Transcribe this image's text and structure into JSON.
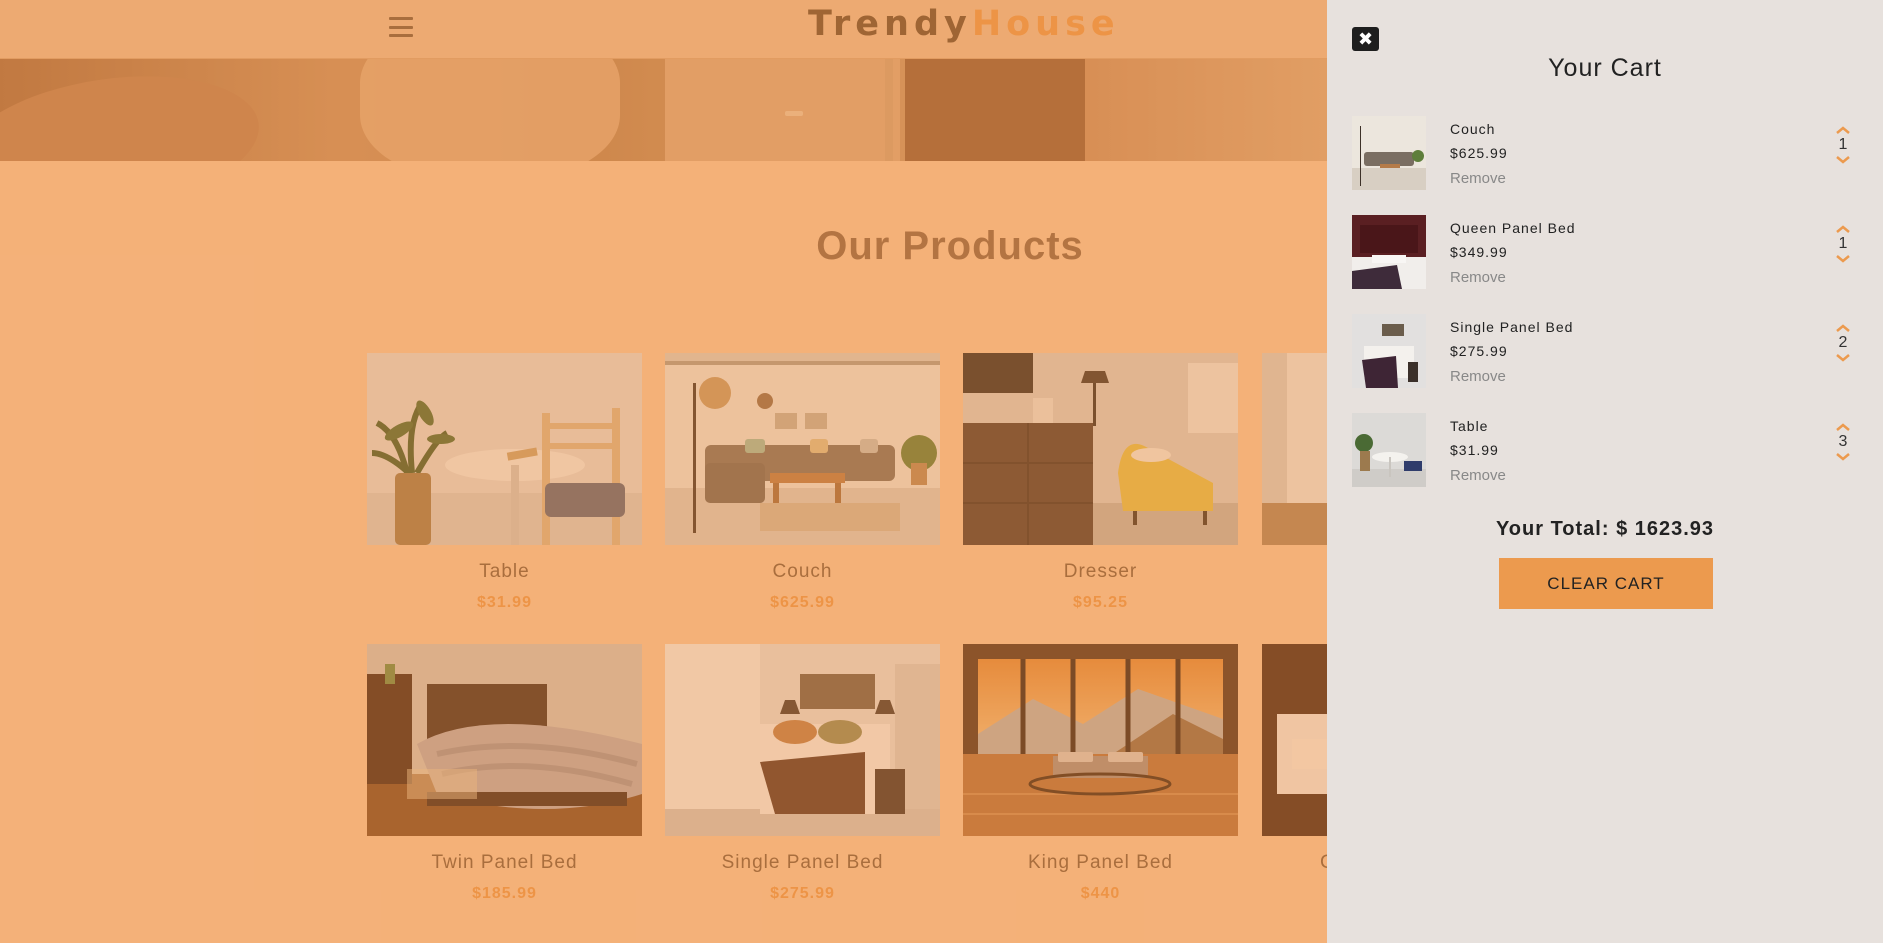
{
  "nav": {
    "menu_icon": "hamburger-icon",
    "logo_part1": "Trendy",
    "logo_part2": "House"
  },
  "products_section": {
    "title": "Our Products",
    "items": [
      {
        "name": "Table",
        "price": "$31.99"
      },
      {
        "name": "Couch",
        "price": "$625.99"
      },
      {
        "name": "Dresser",
        "price": "$95.25"
      },
      {
        "name": "Twin Panel Bed",
        "price": "$185.99"
      },
      {
        "name": "Single Panel Bed",
        "price": "$275.99"
      },
      {
        "name": "King Panel Bed",
        "price": "$440"
      },
      {
        "name": "C",
        "price": ""
      }
    ]
  },
  "cart": {
    "close_icon": "close-icon",
    "title": "Your Cart",
    "items": [
      {
        "name": "Couch",
        "price": "$625.99",
        "remove": "Remove",
        "qty": "1"
      },
      {
        "name": "Queen Panel Bed",
        "price": "$349.99",
        "remove": "Remove",
        "qty": "1"
      },
      {
        "name": "Single Panel Bed",
        "price": "$275.99",
        "remove": "Remove",
        "qty": "2"
      },
      {
        "name": "Table",
        "price": "$31.99",
        "remove": "Remove",
        "qty": "3"
      }
    ],
    "total_label": "Your Total: $ 1623.93",
    "clear_label": "CLEAR CART"
  },
  "colors": {
    "accent": "#ec9a4e",
    "overlay": "#f7caa1",
    "cart_bg": "#e7e1dd"
  }
}
